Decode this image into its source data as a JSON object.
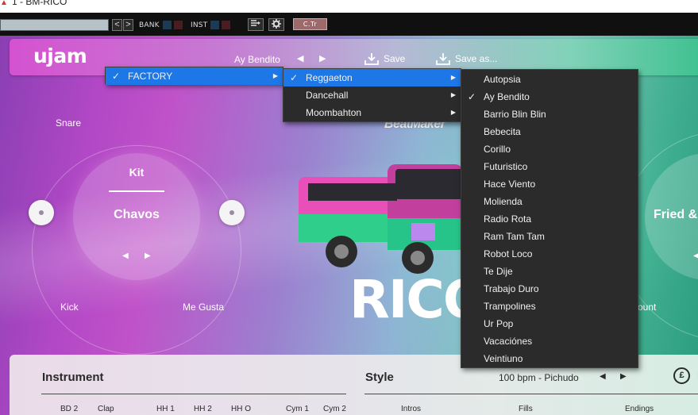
{
  "window": {
    "title": "1 - BM-RICO"
  },
  "hostbar": {
    "bank_label": "BANK",
    "inst_label": "INST",
    "ctr_label": "C.Tr",
    "prev_symbol": "<",
    "next_symbol": ">"
  },
  "header": {
    "logo": "ujam",
    "preset": "Ay Bendito",
    "prev_symbol": "◀",
    "next_symbol": "▶",
    "save_label": "Save",
    "save_as_label": "Save as..."
  },
  "kit": {
    "title": "Kit",
    "value": "Chavos",
    "prev_symbol": "◀",
    "next_symbol": "▶",
    "label_top_left": "Snare",
    "label_bottom_left": "Kick",
    "label_bottom_right": "Me Gusta"
  },
  "center": {
    "brand": "BeatMaker",
    "title": "RICO"
  },
  "style_dial": {
    "value": "Fried &",
    "label_bottom": "ount",
    "next_symbol": "◀"
  },
  "bottom": {
    "instrument_title": "Instrument",
    "style_title": "Style",
    "tempo": "100 bpm - Pichudo",
    "tempo_prev": "◀",
    "tempo_next": "▶",
    "money_symbol": "£",
    "lang": "L",
    "instrument_columns": [
      "BD 2",
      "Clap",
      "HH 1",
      "HH 2",
      "HH O",
      "Cym 1",
      "Cym 2"
    ],
    "style_columns": [
      "Intros",
      "Fills",
      "Endings"
    ]
  },
  "menu_factory": {
    "check": "✓",
    "label": "FACTORY",
    "sub": "▶"
  },
  "menu_genres": {
    "items": [
      {
        "label": "Reggaeton",
        "checked": true,
        "highlighted": true
      },
      {
        "label": "Dancehall",
        "checked": false,
        "highlighted": false
      },
      {
        "label": "Moombahton",
        "checked": false,
        "highlighted": false
      }
    ],
    "check": "✓",
    "sub": "▶"
  },
  "menu_presets": {
    "check": "✓",
    "items": [
      {
        "label": "Autopsia",
        "checked": false
      },
      {
        "label": "Ay Bendito",
        "checked": true
      },
      {
        "label": "Barrio Blin Blin",
        "checked": false
      },
      {
        "label": "Bebecita",
        "checked": false
      },
      {
        "label": "Corillo",
        "checked": false
      },
      {
        "label": "Futuristico",
        "checked": false
      },
      {
        "label": "Hace Viento",
        "checked": false
      },
      {
        "label": "Molienda",
        "checked": false
      },
      {
        "label": "Radio Rota",
        "checked": false
      },
      {
        "label": "Ram Tam Tam",
        "checked": false
      },
      {
        "label": "Robot Loco",
        "checked": false
      },
      {
        "label": "Te Dije",
        "checked": false
      },
      {
        "label": "Trabajo Duro",
        "checked": false
      },
      {
        "label": "Trampolines",
        "checked": false
      },
      {
        "label": "Ur Pop",
        "checked": false
      },
      {
        "label": "Vacaciónes",
        "checked": false
      },
      {
        "label": "Veintiuno",
        "checked": false
      }
    ]
  },
  "colors": {
    "menu_bg": "#2b2b2b",
    "menu_highlight": "#1e77e6",
    "header_left": "#d452d0",
    "header_right": "#3cc08f"
  },
  "icons": {
    "save": "download-tray-icon",
    "save_as": "download-tray-icon",
    "settings": "gear-icon",
    "routing": "routing-icon"
  }
}
